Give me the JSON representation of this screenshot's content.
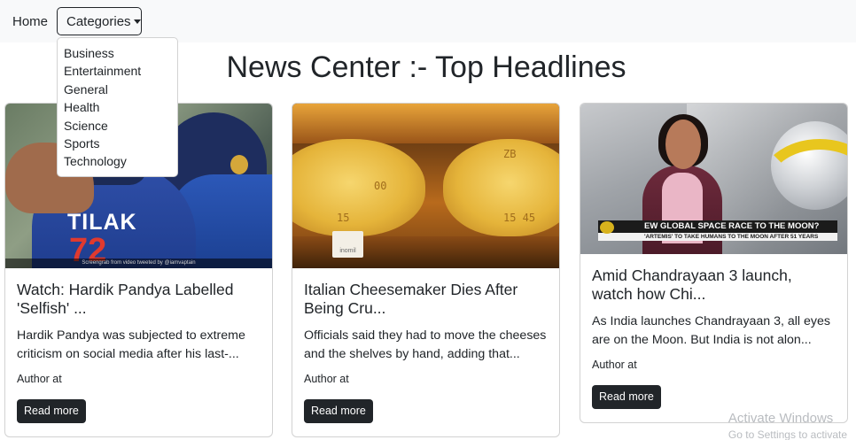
{
  "nav": {
    "home_label": "Home",
    "categories_label": "Categories"
  },
  "dropdown": {
    "items": [
      "Business",
      "Entertainment",
      "General",
      "Health",
      "Science",
      "Sports",
      "Technology"
    ]
  },
  "page_title": "News Center :- Top Headlines",
  "cards": [
    {
      "title": "Watch: Hardik Pandya Labelled 'Selfish' ...",
      "description": "Hardik Pandya was subjected to extreme criticism on social media after his last-...",
      "author": "Author at",
      "button": "Read more",
      "image_text": {
        "jersey_name": "TILAK",
        "jersey_number": "72",
        "caption": "Screengrab from video tweeted by @iamvaptain"
      }
    },
    {
      "title": "Italian Cheesemaker Dies After Being Cru...",
      "description": "Officials said they had to move the cheeses and the shelves by hand, adding that...",
      "author": "Author at",
      "button": "Read more",
      "image_text": {
        "mark_1": "00",
        "mark_2": "ZB",
        "mark_3": "15",
        "mark_4": "15 45",
        "tag": "inomil"
      }
    },
    {
      "title": "Amid Chandrayaan 3 launch, watch how Chi...",
      "description": "As India launches Chandrayaan 3, all eyes are on the Moon. But India is not alon...",
      "author": "Author at",
      "button": "Read more",
      "image_text": {
        "ticker_main": "EW GLOBAL SPACE RACE TO THE MOON?",
        "ticker_sub": "'ARTEMIS' TO TAKE HUMANS TO THE MOON AFTER 51 YEARS",
        "channel": "WION"
      }
    }
  ],
  "watermark": {
    "line1": "Activate Windows",
    "line2": "Go to Settings to activate"
  }
}
